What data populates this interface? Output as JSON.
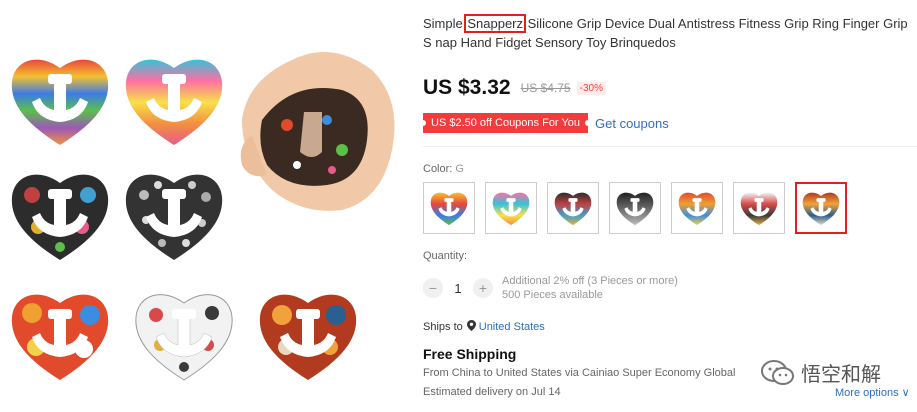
{
  "product": {
    "title_prefix": "Simple ",
    "title_highlight": "Snapperz",
    "title_suffix": " Silicone Grip Device Dual Antistress Fitness Grip Ring Finger Grip S nap Hand Fidget Sensory Toy Brinquedos"
  },
  "pricing": {
    "price": "US $3.32",
    "old_price": "US $4.75",
    "discount": "-30%",
    "coupon_text": "US $2.50 off Coupons For You",
    "get_coupons": "Get coupons"
  },
  "color": {
    "label": "Color:",
    "value": "G",
    "swatches": [
      {
        "name": "A",
        "colors": [
          "#f4c030",
          "#e8473c",
          "#3c7be8",
          "#5bbf4a"
        ]
      },
      {
        "name": "B",
        "colors": [
          "#ff6fa3",
          "#35c3d9",
          "#f8e04a",
          "#f29040"
        ]
      },
      {
        "name": "C",
        "colors": [
          "#2c2c2c",
          "#c04040",
          "#40a0d0",
          "#e0b030"
        ]
      },
      {
        "name": "D",
        "colors": [
          "#222222",
          "#555555",
          "#888888",
          "#bbbbbb"
        ]
      },
      {
        "name": "E",
        "colors": [
          "#e24a2c",
          "#f0a030",
          "#3c8de0",
          "#f2d24a"
        ]
      },
      {
        "name": "F",
        "colors": [
          "#f2f2f2",
          "#d84a4a",
          "#3a3a3a",
          "#e0b040"
        ]
      },
      {
        "name": "G",
        "colors": [
          "#b23a1e",
          "#f2a23a",
          "#2a5f8f",
          "#e8d8c0"
        ]
      }
    ],
    "selected_index": 6
  },
  "quantity": {
    "label": "Quantity:",
    "minus": "−",
    "value": "1",
    "plus": "+",
    "additional": "Additional 2% off (3 Pieces or more)",
    "available": "500 Pieces available"
  },
  "shipping": {
    "ships_to_label": "Ships to",
    "country": "United States",
    "free_shipping": "Free Shipping",
    "detail": "From China to United States via Cainiao Super Economy Global",
    "delivery": "Estimated delivery on Jul 14",
    "more_options": "More options ∨"
  },
  "watermark": {
    "text": "悟空和解"
  }
}
